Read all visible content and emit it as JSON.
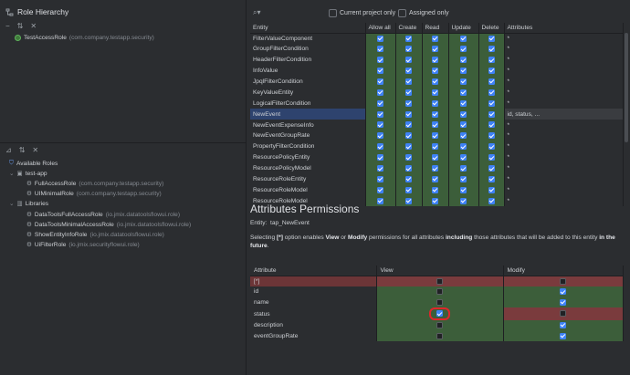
{
  "left_panel": {
    "title": "Role Hierarchy",
    "resource_roles": [
      {
        "name": "TestAccessRole",
        "package": "(com.company.testapp.security)"
      }
    ],
    "available_roles_label": "Available Roles",
    "groups": [
      {
        "name": "test-app",
        "roles": [
          {
            "name": "FullAccessRole",
            "package": "(com.company.testapp.security)"
          },
          {
            "name": "UIMinimalRole",
            "package": "(com.company.testapp.security)"
          }
        ]
      },
      {
        "name": "Libraries",
        "roles": [
          {
            "name": "DataToolsFullAccessRole",
            "package": "(io.jmix.datatoolsflowui.role)"
          },
          {
            "name": "DataToolsMinimalAccessRole",
            "package": "(io.jmix.datatoolsflowui.role)"
          },
          {
            "name": "ShowEntityInfoRole",
            "package": "(io.jmix.datatoolsflowui.role)"
          },
          {
            "name": "UiFilterRole",
            "package": "(io.jmix.securityflowui.role)"
          }
        ]
      }
    ]
  },
  "filters": {
    "current_project_only": "Current project only",
    "assigned_only": "Assigned only"
  },
  "entity_table": {
    "columns": [
      "Entity",
      "Allow all",
      "Create",
      "Read",
      "Update",
      "Delete",
      "Attributes"
    ],
    "rows": [
      {
        "entity": "FilterValueComponent",
        "attributes": "*"
      },
      {
        "entity": "GroupFilterCondition",
        "attributes": "*"
      },
      {
        "entity": "HeaderFilterCondition",
        "attributes": "*"
      },
      {
        "entity": "InfoValue",
        "attributes": "*"
      },
      {
        "entity": "JpqlFilterCondition",
        "attributes": "*"
      },
      {
        "entity": "KeyValueEntity",
        "attributes": "*"
      },
      {
        "entity": "LogicalFilterCondition",
        "attributes": "*"
      },
      {
        "entity": "NewEvent",
        "attributes": "id, status, ...",
        "selected": true
      },
      {
        "entity": "NewEventExpenseInfo",
        "attributes": "*"
      },
      {
        "entity": "NewEventGroupRate",
        "attributes": "*"
      },
      {
        "entity": "PropertyFilterCondition",
        "attributes": "*"
      },
      {
        "entity": "ResourcePolicyEntity",
        "attributes": "*"
      },
      {
        "entity": "ResourcePolicyModel",
        "attributes": "*"
      },
      {
        "entity": "ResourceRoleEntity",
        "attributes": "*"
      },
      {
        "entity": "ResourceRoleModel",
        "attributes": "*"
      },
      {
        "entity": "ResourceRoleModel",
        "attributes": "*"
      }
    ]
  },
  "attributes_permissions": {
    "title": "Attributes Permissions",
    "entity_label": "Entity:",
    "entity_value": "tap_NewEvent",
    "note_parts": {
      "p1": "Selecting ",
      "b1": "[*]",
      "p2": " option enables ",
      "b2": "View",
      "p3": " or ",
      "b3": "Modify",
      "p4": " permissions for all attributes ",
      "b4": "including",
      "p5": " those attributes that will be added to this entity ",
      "b5": "in the future",
      "p6": "."
    },
    "columns": [
      "Attribute",
      "View",
      "Modify"
    ],
    "rows": [
      {
        "name": "[*]",
        "view": false,
        "modify": false
      },
      {
        "name": "id",
        "view": false,
        "modify": true
      },
      {
        "name": "name",
        "view": false,
        "modify": true
      },
      {
        "name": "status",
        "view": true,
        "modify": false
      },
      {
        "name": "description",
        "view": false,
        "modify": true
      },
      {
        "name": "eventGroupRate",
        "view": false,
        "modify": true
      }
    ]
  },
  "colors": {
    "allowed_cell": "#3c5e3a",
    "denied_cell": "#7a3b3d",
    "checkbox_on": "#3e82f7",
    "selection": "#2e436e",
    "highlight": "#e0262b"
  }
}
